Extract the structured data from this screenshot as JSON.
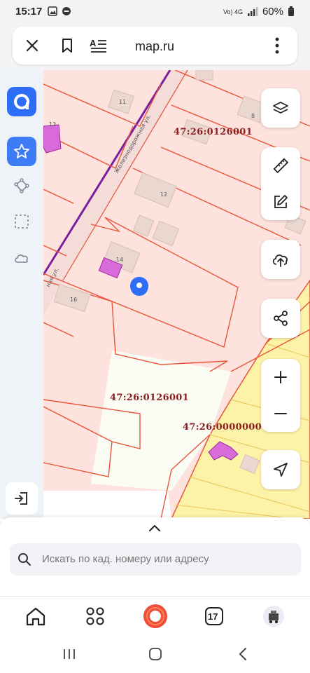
{
  "status_bar": {
    "time": "15:17",
    "network": "Vo) 4G",
    "battery": "60%"
  },
  "browser": {
    "url": "map.ru"
  },
  "map": {
    "street_name": "Железнодорожная ул.",
    "street_name_lower": "ная ул.",
    "cadastral_labels": [
      "47:26:0126001",
      "47:26:0126001",
      "47:26:0000000"
    ],
    "house_numbers": [
      "11",
      "8",
      "12",
      "14",
      "16",
      "13"
    ],
    "colors": {
      "parcel_fill": "#fde2dd",
      "parcel_border": "#e8553a",
      "yellow_zone": "#fdf3a8",
      "building": "#ead7cf",
      "highlight": "#d96ad9",
      "road": "#7a1fa2",
      "accent": "#2e6df6"
    }
  },
  "panel": {
    "icons": [
      "logo-icon",
      "star-icon",
      "polyline-icon",
      "select-area-icon",
      "cloud-icon",
      "login-icon"
    ]
  },
  "map_controls": [
    "layers-icon",
    "ruler-icon",
    "edit-icon",
    "upload-icon",
    "share-icon",
    "zoom-in-icon",
    "zoom-out-icon",
    "locate-icon"
  ],
  "search": {
    "placeholder": "Искать по кад. номеру или адресу"
  },
  "nav": {
    "calendar_day": "17"
  }
}
